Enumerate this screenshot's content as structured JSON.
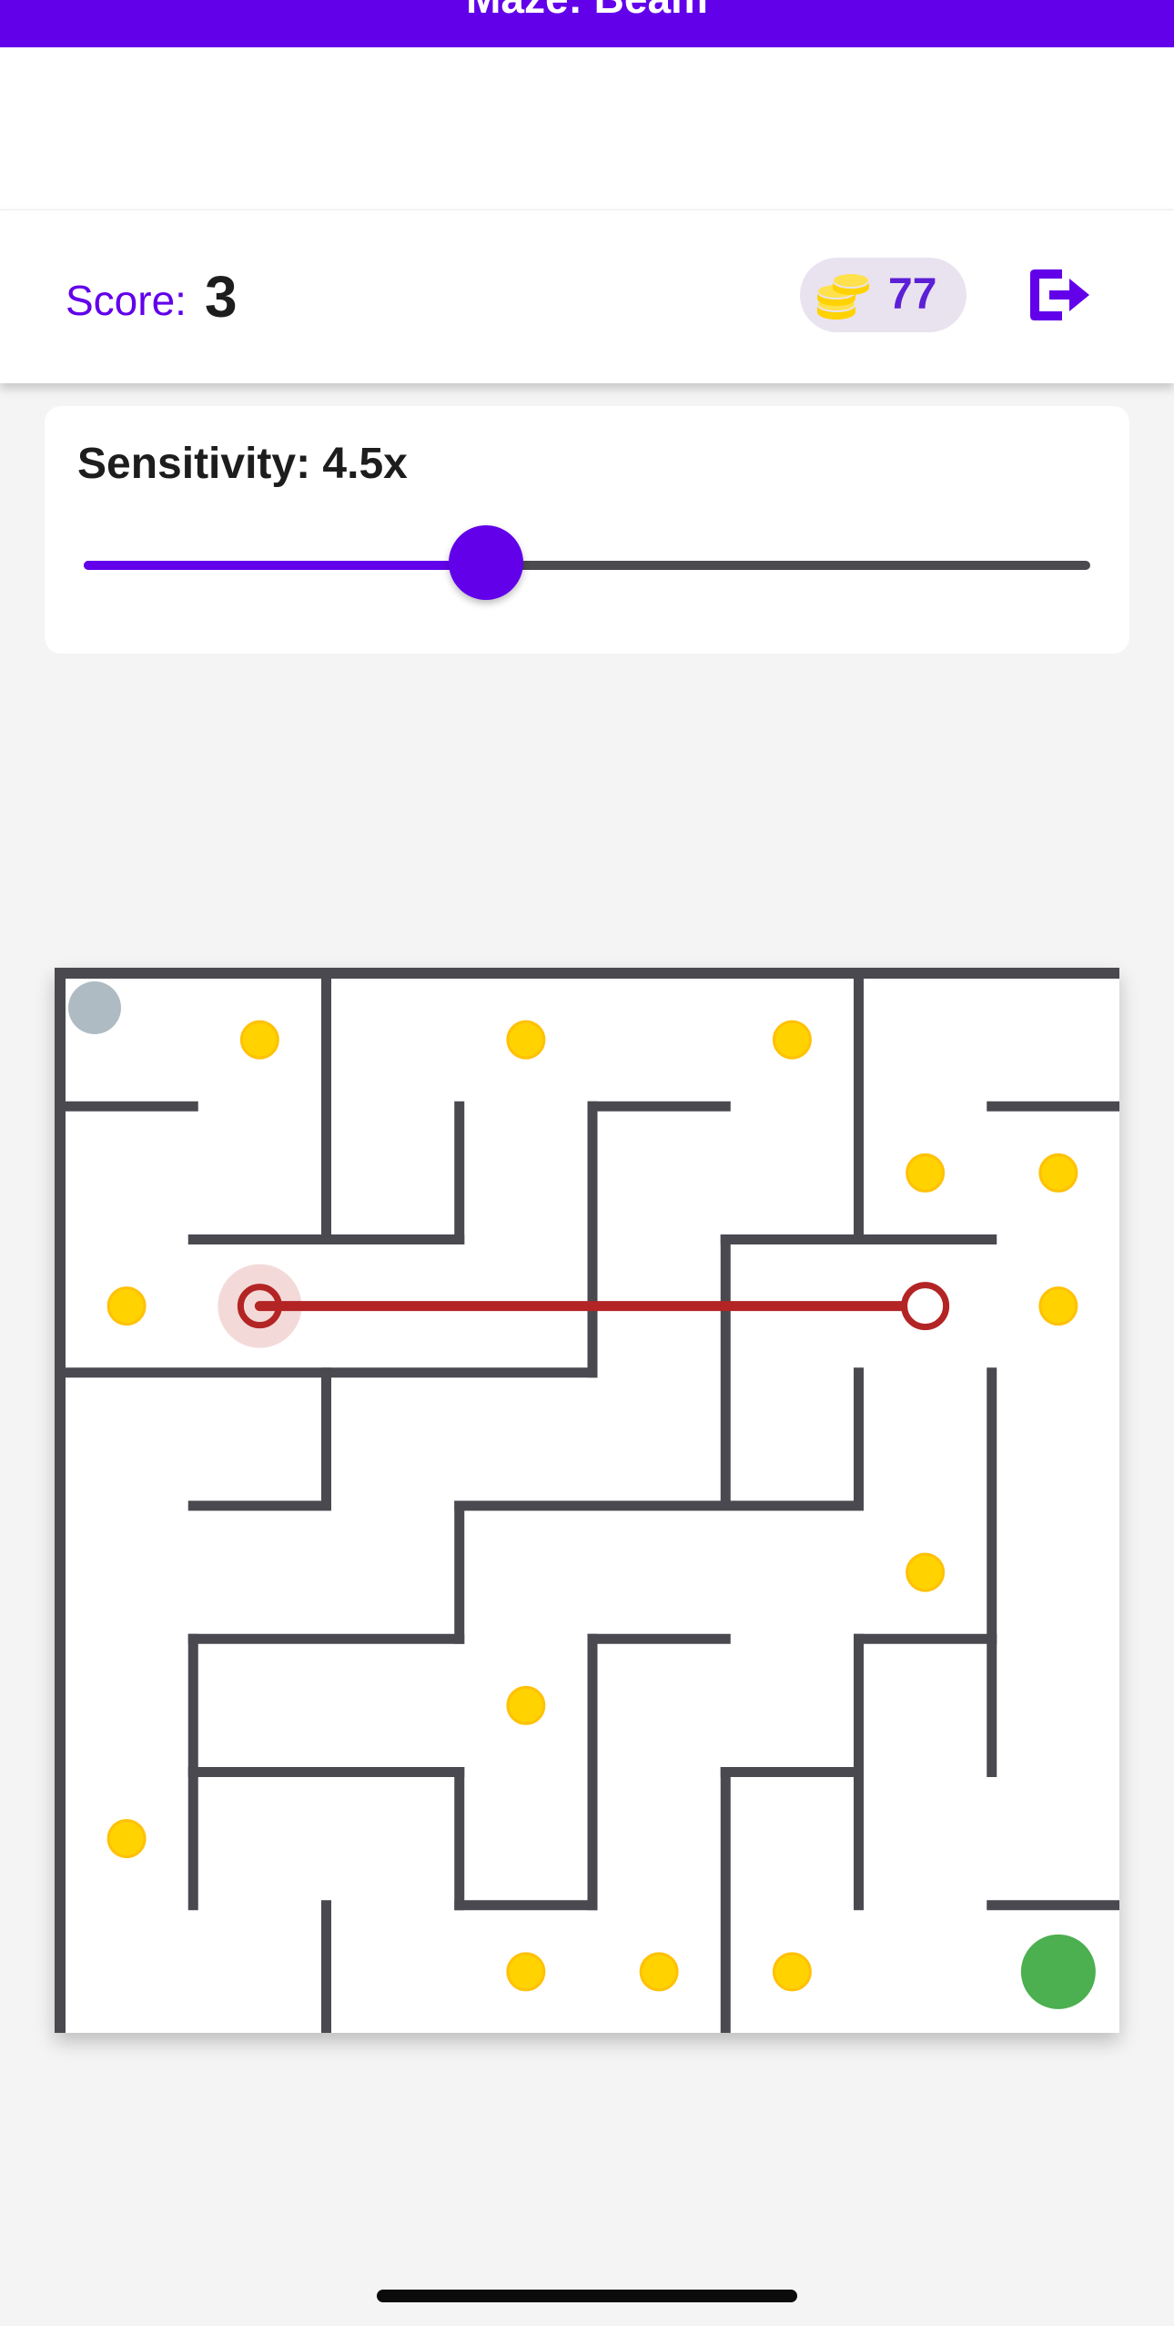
{
  "app_bar": {
    "title": "Maze: Beam",
    "color": "#6200ea"
  },
  "score": {
    "label": "Score:",
    "value": "3"
  },
  "coins": {
    "count": "77",
    "icon": "coin-stack-icon",
    "color": "#ffd200"
  },
  "exit_icon": "exit-icon",
  "sensitivity": {
    "label": "Sensitivity: 4.5x",
    "multiplier": 4.5,
    "fraction": 0.4
  },
  "maze": {
    "rows": 8,
    "cols": 8,
    "wall_color": "#4a4950",
    "player": {
      "row": 0,
      "col": 0,
      "color": "#aebbc3"
    },
    "goal": {
      "row": 7,
      "col": 7,
      "color": "#4caf50"
    },
    "beam": {
      "from": {
        "row": 2,
        "col": 1
      },
      "to": {
        "row": 2,
        "col": 6
      },
      "color": "#b32424"
    },
    "coins": [
      {
        "row": 0,
        "col": 1
      },
      {
        "row": 0,
        "col": 3
      },
      {
        "row": 0,
        "col": 5
      },
      {
        "row": 1,
        "col": 6
      },
      {
        "row": 1,
        "col": 7
      },
      {
        "row": 2,
        "col": 0
      },
      {
        "row": 2,
        "col": 7
      },
      {
        "row": 4,
        "col": 6
      },
      {
        "row": 5,
        "col": 3
      },
      {
        "row": 6,
        "col": 0
      },
      {
        "row": 7,
        "col": 3
      },
      {
        "row": 7,
        "col": 4
      },
      {
        "row": 7,
        "col": 5
      }
    ],
    "h_walls": [
      [
        1,
        0,
        1
      ],
      [
        1,
        4,
        5
      ],
      [
        1,
        7,
        8
      ],
      [
        2,
        1,
        3
      ],
      [
        2,
        5,
        7
      ],
      [
        3,
        0,
        4
      ],
      [
        4,
        1,
        2
      ],
      [
        4,
        3,
        6
      ],
      [
        5,
        1,
        3
      ],
      [
        5,
        4,
        5
      ],
      [
        5,
        6,
        7
      ],
      [
        6,
        1,
        3
      ],
      [
        6,
        5,
        6
      ],
      [
        7,
        3,
        4
      ],
      [
        7,
        7,
        8
      ]
    ],
    "v_walls": [
      [
        2,
        0,
        2
      ],
      [
        3,
        1,
        2
      ],
      [
        4,
        1,
        3
      ],
      [
        6,
        0,
        2
      ],
      [
        5,
        2,
        4
      ],
      [
        2,
        3,
        4
      ],
      [
        6,
        3,
        4
      ],
      [
        7,
        3,
        6
      ],
      [
        3,
        4,
        5
      ],
      [
        1,
        5,
        7
      ],
      [
        4,
        5,
        7
      ],
      [
        6,
        5,
        7
      ],
      [
        3,
        6,
        7
      ],
      [
        5,
        6,
        8
      ],
      [
        2,
        7,
        8
      ]
    ]
  }
}
